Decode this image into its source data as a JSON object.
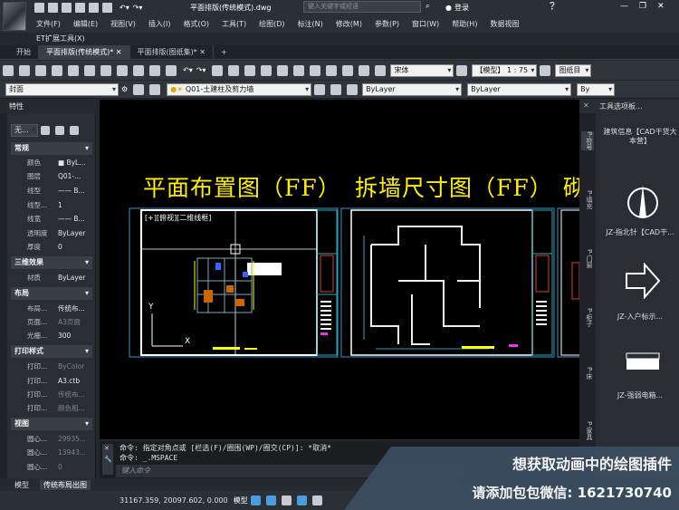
{
  "title_bar": {
    "app_menu_label": "ET扩展工具(X)",
    "doc_title": "平面排版(传统模式).dwg",
    "search_placeholder": "键入关键字或短语",
    "login_label": "登录",
    "menus": [
      "文件(F)",
      "编辑(E)",
      "视图(V)",
      "插入(I)",
      "格式(O)",
      "工具(T)",
      "绘图(D)",
      "标注(N)",
      "修改(M)",
      "参数(P)",
      "窗口(W)",
      "帮助(H)",
      "数据视图"
    ]
  },
  "tabs": [
    "开始",
    "平面排版(传统模式)*",
    "平面排版(图纸集)*"
  ],
  "toolbar": {
    "text_style": "宋体",
    "model_scale": "【模型】 1 : 75",
    "layer_name": "Q01-土建柱及剪力墙",
    "color": "ByLayer",
    "linetype": "ByLayer",
    "lineweight": "By",
    "view_name": "封面",
    "sheet_label": "图纸目"
  },
  "properties": {
    "header": "特性",
    "selection": "无...",
    "sections": [
      {
        "title": "常规",
        "rows": [
          [
            "颜色",
            "■ ByL..."
          ],
          [
            "图层",
            "Q01-..."
          ],
          [
            "线型",
            "—— B..."
          ],
          [
            "线型...",
            "1"
          ],
          [
            "线宽",
            "—— B..."
          ],
          [
            "透明度",
            "ByLayer"
          ],
          [
            "厚度",
            "0"
          ]
        ]
      },
      {
        "title": "三维效果",
        "rows": [
          [
            "材质",
            "ByLayer"
          ]
        ]
      },
      {
        "title": "布局",
        "rows": [
          [
            "布局...",
            "传统布..."
          ],
          [
            "页面...",
            "A3页面"
          ],
          [
            "光栅...",
            "300"
          ]
        ]
      },
      {
        "title": "打印样式",
        "rows": [
          [
            "打印...",
            "ByColor"
          ],
          [
            "打印...",
            "A3.ctb"
          ],
          [
            "打印...",
            "传统布..."
          ],
          [
            "打印...",
            "颜色相..."
          ]
        ]
      },
      {
        "title": "视图",
        "rows": [
          [
            "圆心...",
            "29935..."
          ],
          [
            "圆心...",
            "13943..."
          ],
          [
            "圆心...",
            "0"
          ]
        ]
      }
    ]
  },
  "canvas": {
    "title_left": "平面布置图（FF）",
    "title_right": "拆墙尺寸图（FF）",
    "title_partial": "砌",
    "viewport_label": "[+][俯视][二维线框]",
    "ucs_y": "Y",
    "ucs_x": "X"
  },
  "right_panel": {
    "header": "工具选项板...",
    "tabs": [
      "P-符号",
      "P-填充",
      "P-门窗",
      "P-柜子",
      "P-床",
      "P-家具"
    ],
    "items": [
      "建筑信息【CAD干货大本营】",
      "JZ-指北针【CAD干...",
      "JZ-入户标示...",
      "JZ-强弱电箱..."
    ]
  },
  "command": {
    "line1": "命令: 指定对角点或 [栏选(F)/圈围(WP)/圈交(CP)]: *取消*",
    "line2": "命令: _.MSPACE",
    "input_placeholder": "键入命令"
  },
  "layouts": [
    "模型",
    "传统布局出图"
  ],
  "status": {
    "coords": "31167.359, 20097.602, 0.000",
    "model_label": "模型"
  },
  "banner": {
    "line1": "想获取动画中的绘图插件",
    "line2": "请添加包包微信: 1621730740"
  }
}
